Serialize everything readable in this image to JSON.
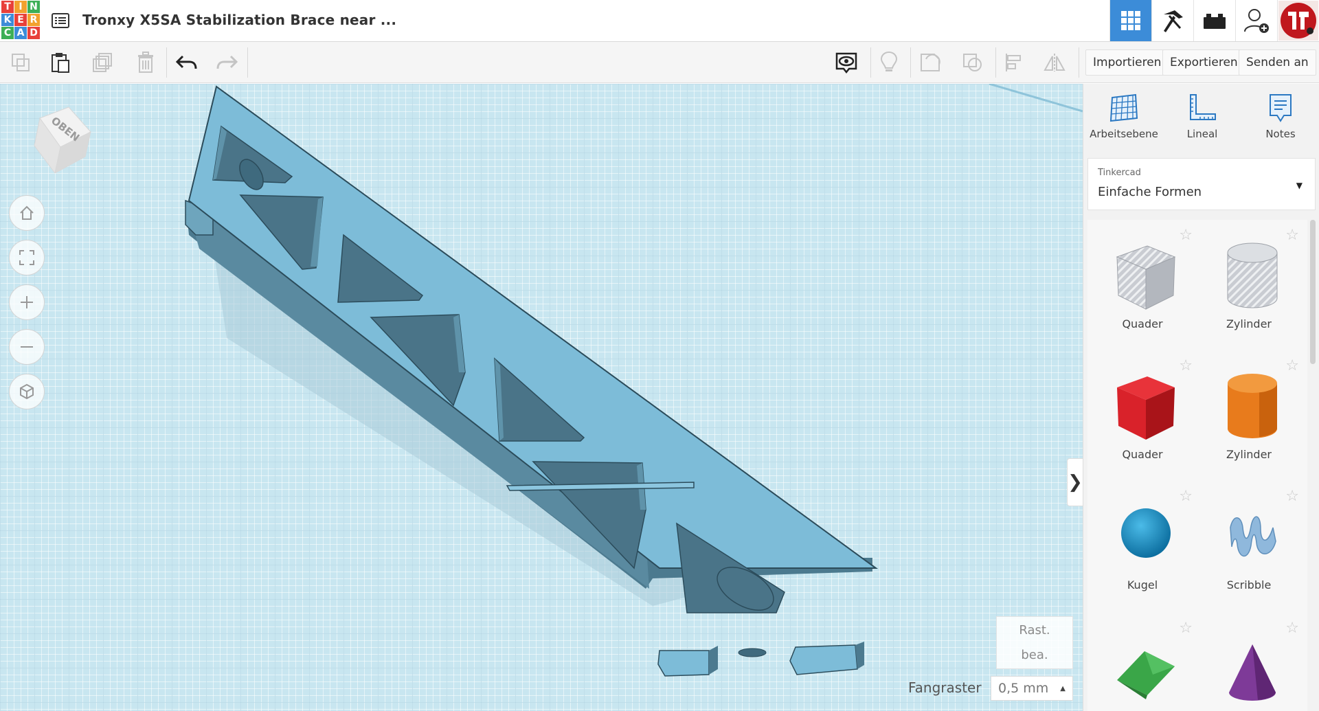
{
  "app": {
    "logo_letters": [
      "T",
      "I",
      "N",
      "K",
      "E",
      "R",
      "C",
      "A",
      "D"
    ],
    "logo_colors": [
      "#e8403a",
      "#f2a12e",
      "#3daf57",
      "#3c8cd8",
      "#e8403a",
      "#f2a12e",
      "#3daf57",
      "#3c8cd8",
      "#e8403a"
    ],
    "title": "Tronxy X5SA Stabilization Brace near ..."
  },
  "topbar": {
    "icons": [
      "design-grid-icon",
      "build-tool-icon",
      "bricks-icon",
      "add-user-icon",
      "profile-avatar"
    ],
    "active_color": "#3c8cd8"
  },
  "toolbar": {
    "tools_left": [
      "copy-icon",
      "paste-icon",
      "duplicate-icon",
      "delete-icon",
      "undo-icon",
      "redo-icon"
    ],
    "tools_right": [
      "show-all-icon",
      "lightbulb-icon",
      "group-icon",
      "ungroup-icon",
      "align-icon",
      "mirror-icon"
    ],
    "import_label": "Importieren",
    "export_label": "Exportieren",
    "send_label": "Senden an"
  },
  "viewport": {
    "navcube_label": "OBEN",
    "view_controls": [
      "home-icon",
      "fit-view-icon",
      "zoom-in-icon",
      "zoom-out-icon",
      "orthographic-icon"
    ],
    "edit_grid_line1": "Rast.",
    "edit_grid_line2": "bea.",
    "snap_label": "Fangraster",
    "snap_value": "0,5 mm",
    "panel_toggle": "❯",
    "model_color": "#7dbcd8"
  },
  "panel": {
    "tabs": [
      {
        "label": "Arbeitsebene",
        "icon": "workplane-icon"
      },
      {
        "label": "Lineal",
        "icon": "ruler-icon"
      },
      {
        "label": "Notes",
        "icon": "notes-icon"
      }
    ],
    "library_source": "Tinkercad",
    "library_name": "Einfache Formen",
    "shapes": [
      {
        "label": "Quader",
        "color": "#b8bcc4",
        "icon": "box-hole-icon"
      },
      {
        "label": "Zylinder",
        "color": "#c3c6cc",
        "icon": "cylinder-hole-icon"
      },
      {
        "label": "Quader",
        "color": "#d9222a",
        "icon": "box-icon"
      },
      {
        "label": "Zylinder",
        "color": "#e87b1c",
        "icon": "cylinder-icon"
      },
      {
        "label": "Kugel",
        "color": "#1b95cf",
        "icon": "sphere-icon"
      },
      {
        "label": "Scribble",
        "color": "#8fb8dc",
        "icon": "scribble-icon"
      },
      {
        "label": "",
        "color": "#3aa648",
        "icon": "roof-icon"
      },
      {
        "label": "",
        "color": "#7e3a98",
        "icon": "cone-icon"
      }
    ]
  }
}
